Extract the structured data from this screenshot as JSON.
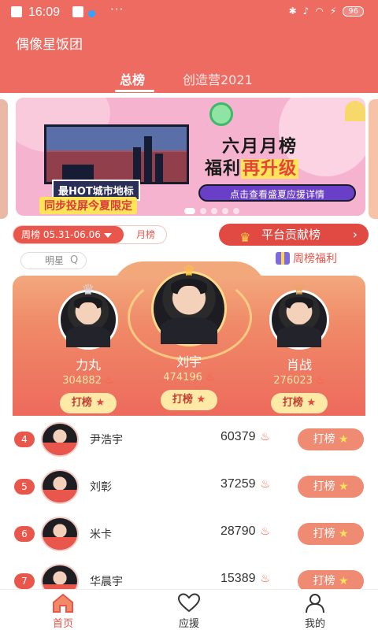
{
  "status": {
    "time": "16:09",
    "more": "···",
    "battery": "96"
  },
  "app_title": "偶像星饭团",
  "tabs": [
    {
      "label": "总榜",
      "active": true
    },
    {
      "label": "创造营2021",
      "active": false
    }
  ],
  "banner": {
    "caption_top": "最HOT城市地标",
    "caption_bottom": "同步投屏今夏限定",
    "title_line1": "六月月榜",
    "title_line2_a": "福利",
    "title_line2_b": "再升级",
    "cta": "点击查看盛夏应援详情"
  },
  "filters": {
    "week_label": "周榜 05.31-06.06",
    "month_label": "月榜"
  },
  "contribution_button": "平台贡献榜",
  "star_search": {
    "label": "明星"
  },
  "weekly_benefit": "周榜福利",
  "podium": [
    {
      "rank": "2",
      "name": "力丸",
      "score": "304882",
      "button": "打榜"
    },
    {
      "rank": "1",
      "name": "刘宇",
      "score": "474196",
      "button": "打榜"
    },
    {
      "rank": "3",
      "name": "肖战",
      "score": "276023",
      "button": "打榜"
    }
  ],
  "list": [
    {
      "rank": "4",
      "name": "尹浩宇",
      "score": "60379",
      "button": "打榜"
    },
    {
      "rank": "5",
      "name": "刘彰",
      "score": "37259",
      "button": "打榜"
    },
    {
      "rank": "6",
      "name": "米卡",
      "score": "28790",
      "button": "打榜"
    },
    {
      "rank": "7",
      "name": "华晨宇",
      "score": "15389",
      "button": "打榜"
    }
  ],
  "bottom_nav": [
    {
      "label": "首页",
      "icon": "home-icon",
      "active": true
    },
    {
      "label": "应援",
      "icon": "heart-icon",
      "active": false
    },
    {
      "label": "我的",
      "icon": "person-icon",
      "active": false
    }
  ],
  "colors": {
    "primary": "#ee6b62",
    "accent_red": "#e9564c",
    "gold": "#ffe9a6"
  }
}
